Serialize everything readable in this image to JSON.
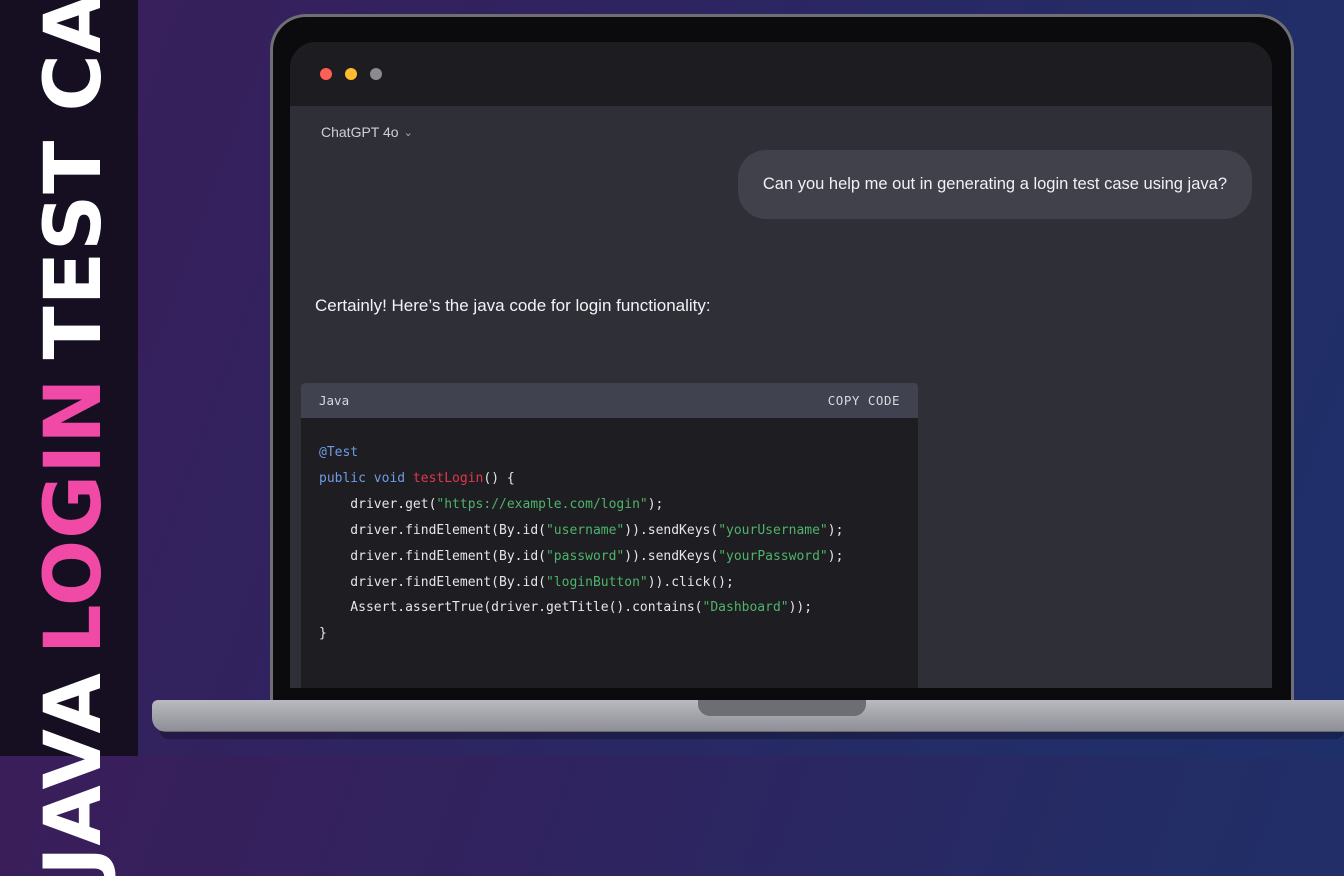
{
  "banner": {
    "word1": "JAVA",
    "word2": "LOGIN",
    "word3": "TEST CASE"
  },
  "window": {
    "traffic_lights": [
      "close",
      "minimize",
      "zoom"
    ]
  },
  "chat": {
    "model_label": "ChatGPT 4o",
    "model_chevron": "⌄",
    "user_message": "Can you help me out in generating a login test case using java?",
    "assistant_message": "Certainly! Here’s the java code for login functionality:"
  },
  "code": {
    "language": "Java",
    "copy_label": "COPY CODE",
    "lines": [
      [
        {
          "t": "@Test",
          "c": "ann"
        }
      ],
      [
        {
          "t": "public void ",
          "c": "kw"
        },
        {
          "t": "testLogin",
          "c": "fn"
        },
        {
          "t": "() {",
          "c": ""
        }
      ],
      [
        {
          "t": "    driver.get(",
          "c": ""
        },
        {
          "t": "\"https://example.com/login\"",
          "c": "str"
        },
        {
          "t": ");",
          "c": ""
        }
      ],
      [
        {
          "t": "    driver.findElement(By.id(",
          "c": ""
        },
        {
          "t": "\"username\"",
          "c": "str"
        },
        {
          "t": ")).sendKeys(",
          "c": ""
        },
        {
          "t": "\"yourUsername\"",
          "c": "str"
        },
        {
          "t": ");",
          "c": ""
        }
      ],
      [
        {
          "t": "    driver.findElement(By.id(",
          "c": ""
        },
        {
          "t": "\"password\"",
          "c": "str"
        },
        {
          "t": ")).sendKeys(",
          "c": ""
        },
        {
          "t": "\"yourPassword\"",
          "c": "str"
        },
        {
          "t": ");",
          "c": ""
        }
      ],
      [
        {
          "t": "    driver.findElement(By.id(",
          "c": ""
        },
        {
          "t": "\"loginButton\"",
          "c": "str"
        },
        {
          "t": ")).click();",
          "c": ""
        }
      ],
      [
        {
          "t": "    Assert.assertTrue(driver.getTitle().contains(",
          "c": ""
        },
        {
          "t": "\"Dashboard\"",
          "c": "str"
        },
        {
          "t": "));",
          "c": ""
        }
      ],
      [
        {
          "t": "}",
          "c": ""
        }
      ]
    ]
  },
  "colors": {
    "keyword": "#6f9ce6",
    "function": "#e0384c",
    "string": "#4fb36a",
    "banner_accent": "#f04aa6"
  }
}
